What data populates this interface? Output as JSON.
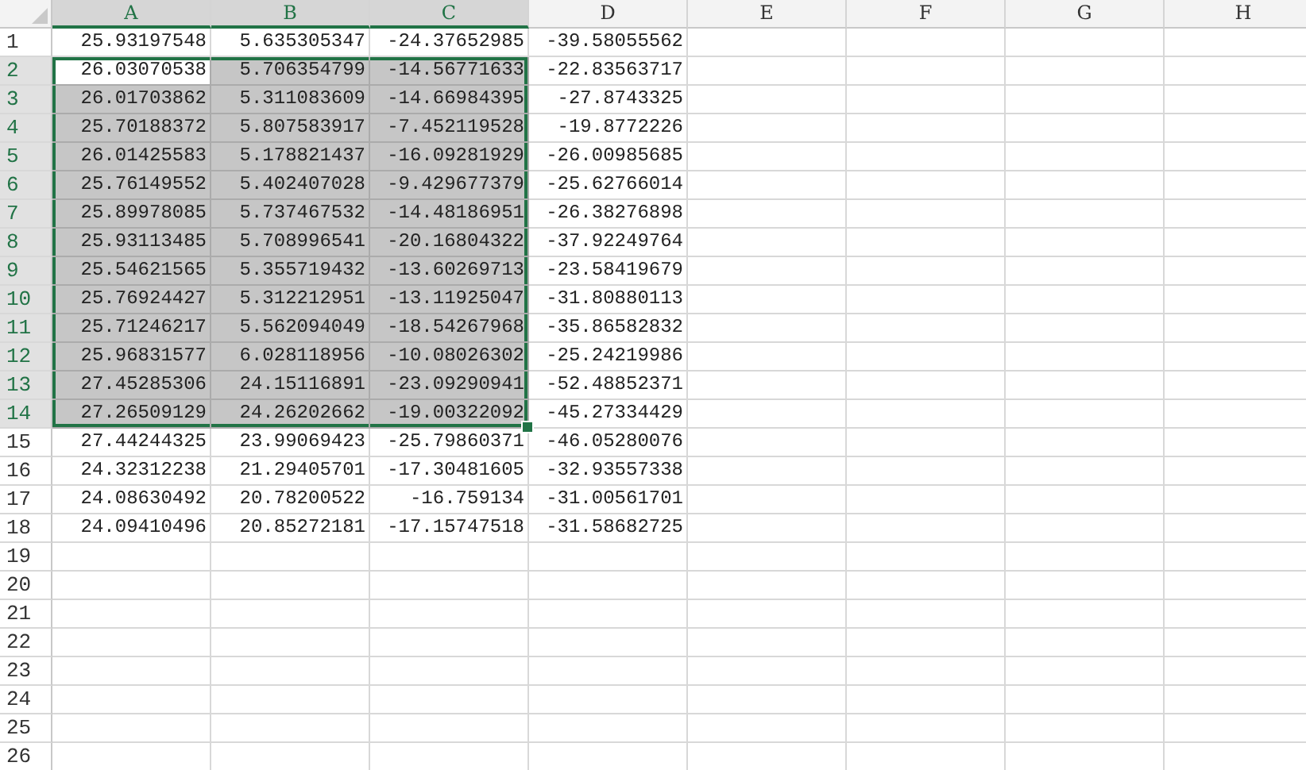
{
  "columns": [
    {
      "label": "A",
      "selected": true
    },
    {
      "label": "B",
      "selected": true
    },
    {
      "label": "C",
      "selected": true
    },
    {
      "label": "D",
      "selected": false
    },
    {
      "label": "E",
      "selected": false
    },
    {
      "label": "F",
      "selected": false
    },
    {
      "label": "G",
      "selected": false
    },
    {
      "label": "H",
      "selected": false
    }
  ],
  "rows": [
    {
      "number": "1",
      "selected": false,
      "cells": [
        {
          "text": "25.93197548",
          "active": false
        },
        {
          "text": "5.635305347",
          "active": false
        },
        {
          "text": "-24.37652985",
          "active": false
        },
        {
          "text": "-39.58055562",
          "active": false
        }
      ]
    },
    {
      "number": "2",
      "selected": true,
      "cells": [
        {
          "text": "26.03070538",
          "active": true
        },
        {
          "text": "5.706354799",
          "active": false
        },
        {
          "text": "-14.56771633",
          "active": false
        },
        {
          "text": "-22.83563717",
          "active": false
        }
      ]
    },
    {
      "number": "3",
      "selected": true,
      "cells": [
        {
          "text": "26.01703862",
          "active": false
        },
        {
          "text": "5.311083609",
          "active": false
        },
        {
          "text": "-14.66984395",
          "active": false
        },
        {
          "text": "-27.8743325",
          "active": false
        }
      ]
    },
    {
      "number": "4",
      "selected": true,
      "cells": [
        {
          "text": "25.70188372",
          "active": false
        },
        {
          "text": "5.807583917",
          "active": false
        },
        {
          "text": "-7.452119528",
          "active": false
        },
        {
          "text": "-19.8772226",
          "active": false
        }
      ]
    },
    {
      "number": "5",
      "selected": true,
      "cells": [
        {
          "text": "26.01425583",
          "active": false
        },
        {
          "text": "5.178821437",
          "active": false
        },
        {
          "text": "-16.09281929",
          "active": false
        },
        {
          "text": "-26.00985685",
          "active": false
        }
      ]
    },
    {
      "number": "6",
      "selected": true,
      "cells": [
        {
          "text": "25.76149552",
          "active": false
        },
        {
          "text": "5.402407028",
          "active": false
        },
        {
          "text": "-9.429677379",
          "active": false
        },
        {
          "text": "-25.62766014",
          "active": false
        }
      ]
    },
    {
      "number": "7",
      "selected": true,
      "cells": [
        {
          "text": "25.89978085",
          "active": false
        },
        {
          "text": "5.737467532",
          "active": false
        },
        {
          "text": "-14.48186951",
          "active": false
        },
        {
          "text": "-26.38276898",
          "active": false
        }
      ]
    },
    {
      "number": "8",
      "selected": true,
      "cells": [
        {
          "text": "25.93113485",
          "active": false
        },
        {
          "text": "5.708996541",
          "active": false
        },
        {
          "text": "-20.16804322",
          "active": false
        },
        {
          "text": "-37.92249764",
          "active": false
        }
      ]
    },
    {
      "number": "9",
      "selected": true,
      "cells": [
        {
          "text": "25.54621565",
          "active": false
        },
        {
          "text": "5.355719432",
          "active": false
        },
        {
          "text": "-13.60269713",
          "active": false
        },
        {
          "text": "-23.58419679",
          "active": false
        }
      ]
    },
    {
      "number": "10",
      "selected": true,
      "cells": [
        {
          "text": "25.76924427",
          "active": false
        },
        {
          "text": "5.312212951",
          "active": false
        },
        {
          "text": "-13.11925047",
          "active": false
        },
        {
          "text": "-31.80880113",
          "active": false
        }
      ]
    },
    {
      "number": "11",
      "selected": true,
      "cells": [
        {
          "text": "25.71246217",
          "active": false
        },
        {
          "text": "5.562094049",
          "active": false
        },
        {
          "text": "-18.54267968",
          "active": false
        },
        {
          "text": "-35.86582832",
          "active": false
        }
      ]
    },
    {
      "number": "12",
      "selected": true,
      "cells": [
        {
          "text": "25.96831577",
          "active": false
        },
        {
          "text": "6.028118956",
          "active": false
        },
        {
          "text": "-10.08026302",
          "active": false
        },
        {
          "text": "-25.24219986",
          "active": false
        }
      ]
    },
    {
      "number": "13",
      "selected": true,
      "cells": [
        {
          "text": "27.45285306",
          "active": false
        },
        {
          "text": "24.15116891",
          "active": false
        },
        {
          "text": "-23.09290941",
          "active": false
        },
        {
          "text": "-52.48852371",
          "active": false
        }
      ]
    },
    {
      "number": "14",
      "selected": true,
      "cells": [
        {
          "text": "27.26509129",
          "active": false
        },
        {
          "text": "24.26202662",
          "active": false
        },
        {
          "text": "-19.00322092",
          "active": false
        },
        {
          "text": "-45.27334429",
          "active": false
        }
      ]
    },
    {
      "number": "15",
      "selected": false,
      "cells": [
        {
          "text": "27.44244325",
          "active": false
        },
        {
          "text": "23.99069423",
          "active": false
        },
        {
          "text": "-25.79860371",
          "active": false
        },
        {
          "text": "-46.05280076",
          "active": false
        }
      ]
    },
    {
      "number": "16",
      "selected": false,
      "cells": [
        {
          "text": "24.32312238",
          "active": false
        },
        {
          "text": "21.29405701",
          "active": false
        },
        {
          "text": "-17.30481605",
          "active": false
        },
        {
          "text": "-32.93557338",
          "active": false
        }
      ]
    },
    {
      "number": "17",
      "selected": false,
      "cells": [
        {
          "text": "24.08630492",
          "active": false
        },
        {
          "text": "20.78200522",
          "active": false
        },
        {
          "text": "-16.759134",
          "active": false
        },
        {
          "text": "-31.00561701",
          "active": false
        }
      ]
    },
    {
      "number": "18",
      "selected": false,
      "cells": [
        {
          "text": "24.09410496",
          "active": false
        },
        {
          "text": "20.85272181",
          "active": false
        },
        {
          "text": "-17.15747518",
          "active": false
        },
        {
          "text": "-31.58682725",
          "active": false
        }
      ]
    },
    {
      "number": "19",
      "selected": false,
      "cells": []
    },
    {
      "number": "20",
      "selected": false,
      "cells": []
    },
    {
      "number": "21",
      "selected": false,
      "cells": []
    },
    {
      "number": "22",
      "selected": false,
      "cells": []
    },
    {
      "number": "23",
      "selected": false,
      "cells": []
    },
    {
      "number": "24",
      "selected": false,
      "cells": []
    },
    {
      "number": "25",
      "selected": false,
      "cells": []
    },
    {
      "number": "26",
      "selected": false,
      "cells": []
    }
  ]
}
